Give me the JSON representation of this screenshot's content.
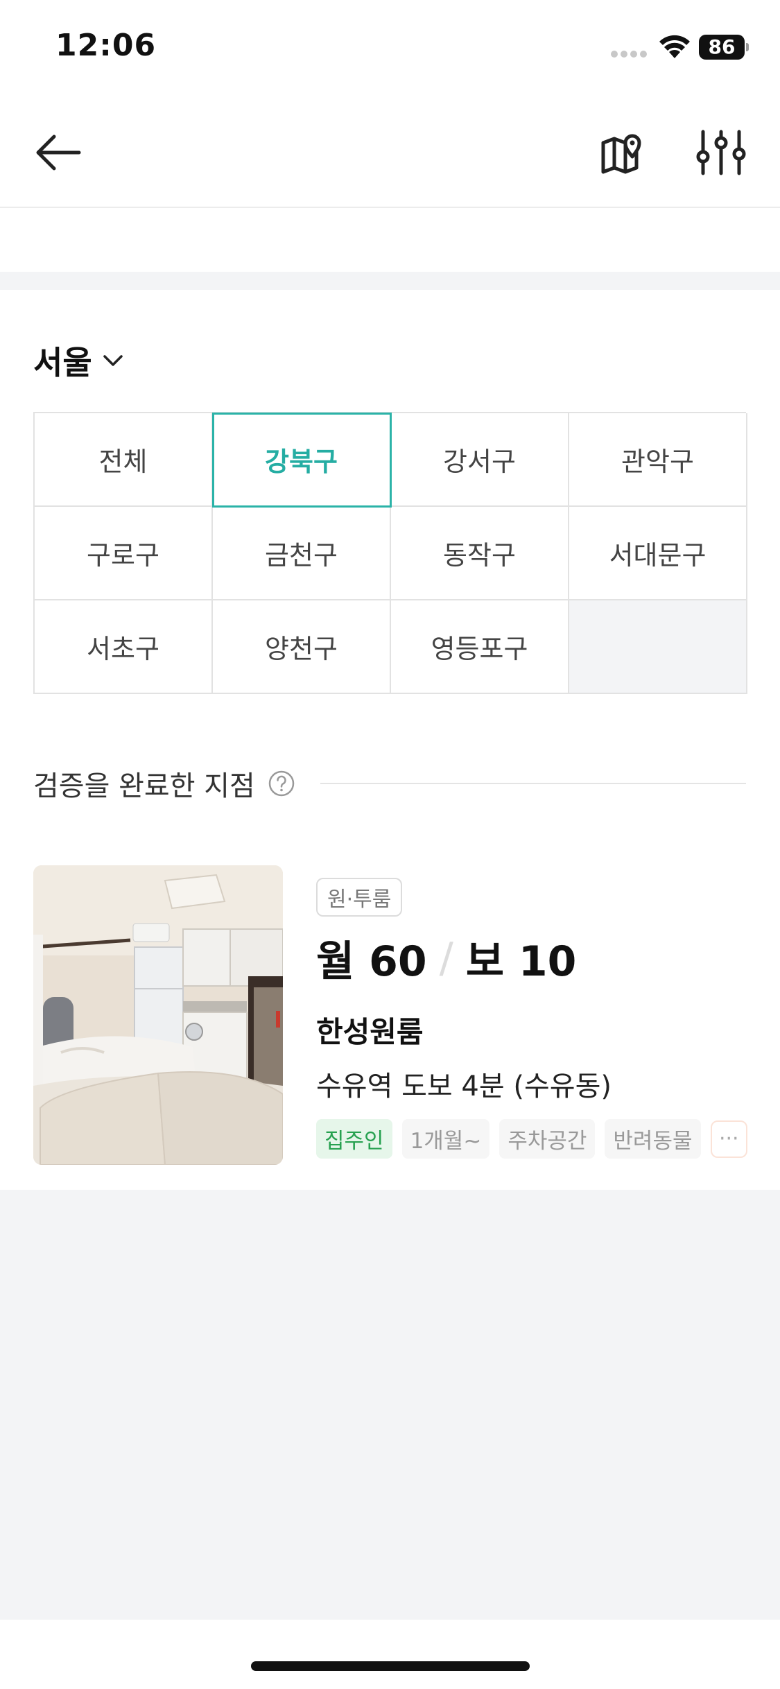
{
  "status_bar": {
    "time": "12:06",
    "battery": "86",
    "icons": [
      "signal-icon",
      "wifi-icon",
      "battery-icon"
    ]
  },
  "nav": {
    "icons": [
      "back-arrow-icon",
      "map-icon",
      "filter-sliders-icon"
    ]
  },
  "region": {
    "label": "서울",
    "icon": "chevron-down-icon"
  },
  "districts": {
    "items": [
      "전체",
      "강북구",
      "강서구",
      "관악구",
      "구로구",
      "금천구",
      "동작구",
      "서대문구",
      "서초구",
      "양천구",
      "영등포구"
    ],
    "selected": "강북구"
  },
  "section": {
    "title": "검증을 완료한 지점",
    "help_icon": "question-circle-icon"
  },
  "listing": {
    "room_type": "원·투룸",
    "price_monthly": "월 60",
    "price_sep": "/",
    "price_deposit": "보 10",
    "name": "한성원룸",
    "location": "수유역 도보 4분 (수유동)",
    "tags": [
      "집주인",
      "1개월~",
      "주차공간",
      "반려동물"
    ],
    "more": "···"
  },
  "colors": {
    "accent": "#25ada3",
    "owner_tag_text": "#27a150",
    "owner_tag_bg": "#e6f6ea",
    "gray_bg": "#f3f4f6"
  }
}
